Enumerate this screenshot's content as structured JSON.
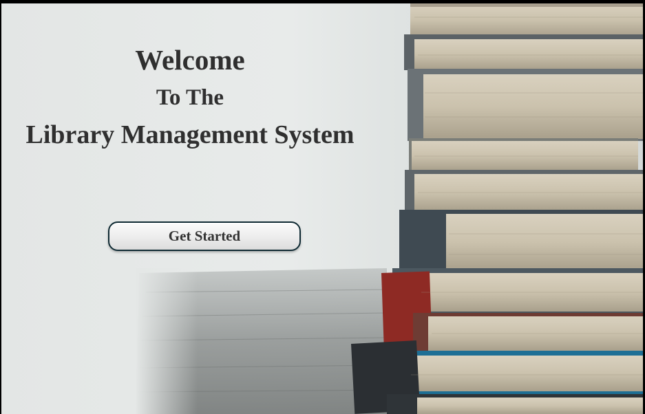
{
  "hero": {
    "line1": "Welcome",
    "line2": "To The",
    "line3": "Library Management System"
  },
  "actions": {
    "get_started_label": "Get Started"
  },
  "colors": {
    "heading_text": "#2f2f2f",
    "button_border": "#0f2a33",
    "background": "#e6e9e8"
  },
  "background_image": "stack-of-books-photo"
}
